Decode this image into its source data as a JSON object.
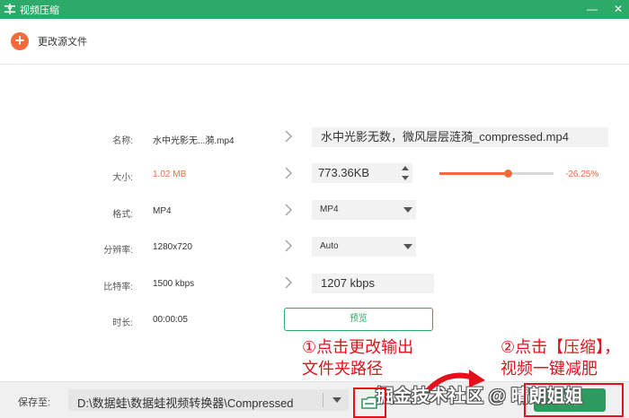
{
  "window": {
    "title": "视频压缩",
    "minimize_glyph": "—",
    "close_glyph": "✕"
  },
  "toolbar": {
    "add_icon": "plus-icon",
    "change_source_label": "更改源文件"
  },
  "fields": {
    "name": {
      "label": "名称:",
      "source": "水中光影无...漪.mp4",
      "output": "水中光影无数，微风层层涟漪_compressed.mp4"
    },
    "size": {
      "label": "大小:",
      "source": "1.02 MB",
      "output": "773.36KB",
      "percent": "-26.25%",
      "slider_fraction": 0.6
    },
    "format": {
      "label": "格式:",
      "source": "MP4",
      "output": "MP4"
    },
    "resolution": {
      "label": "分辨率:",
      "source": "1280x720",
      "output": "Auto"
    },
    "bitrate": {
      "label": "比特率:",
      "source": "1500 kbps",
      "output": "1207 kbps"
    },
    "duration": {
      "label": "时长:",
      "source": "00:00:05"
    }
  },
  "preview_label": "预览",
  "annotations": {
    "step1_line1": "①点击更改输出",
    "step1_line2": "文件夹路径",
    "step2_line1": "②点击【压缩】，",
    "step2_line2": "视频一键减肥"
  },
  "bottom": {
    "save_label": "保存至:",
    "path": "D:\\数据蛙\\数据蛙视频转换器\\Compressed",
    "compress_label": "压缩"
  },
  "watermark": "掘金技术社区 @ 晴朗姐姐",
  "colors": {
    "brand_green": "#2daa69",
    "accent_orange": "#f26b3a",
    "annotation_red": "#e4101c"
  }
}
